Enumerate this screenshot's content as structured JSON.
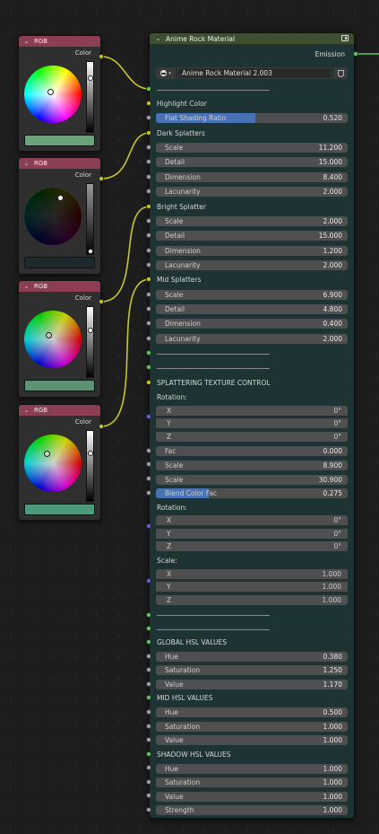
{
  "rgb_nodes": [
    {
      "title": "RGB",
      "output": "Color",
      "swatch_color": "#6aa27a"
    },
    {
      "title": "RGB",
      "output": "Color",
      "swatch_color": "#1c2a2e"
    },
    {
      "title": "RGB",
      "output": "Color",
      "swatch_color": "#5e9272"
    },
    {
      "title": "RGB",
      "output": "Color",
      "swatch_color": "#4e9a7c"
    }
  ],
  "main_node": {
    "title": "Anime Rock Material",
    "output": "Emission",
    "material_name": "Anime Rock Material 2.003",
    "highlight_color": "Highlight Color",
    "flat_shading": {
      "label": "Flat Shading Ratio",
      "value": "0.520",
      "fraction": 0.52
    },
    "dark_splatters": {
      "title": "Dark Splatters",
      "fields": [
        {
          "label": "Scale",
          "value": "11.200"
        },
        {
          "label": "Detail",
          "value": "15.000"
        },
        {
          "label": "Dimension",
          "value": "8.400"
        },
        {
          "label": "Lacunarity",
          "value": "2.000"
        }
      ]
    },
    "bright_splatter": {
      "title": "Bright Splatter",
      "fields": [
        {
          "label": "Scale",
          "value": "2.000"
        },
        {
          "label": "Detail",
          "value": "15.000"
        },
        {
          "label": "Dimension",
          "value": "1.200"
        },
        {
          "label": "Lacunarity",
          "value": "2.000"
        }
      ]
    },
    "mid_splatters": {
      "title": "Mid Splatters",
      "fields": [
        {
          "label": "Scale",
          "value": "6.900"
        },
        {
          "label": "Detail",
          "value": "4.800"
        },
        {
          "label": "Dimension",
          "value": "0.400"
        },
        {
          "label": "Lacunarity",
          "value": "2.000"
        }
      ]
    },
    "splattering": {
      "title": "SPLATTERING TEXTURE CONTROL",
      "rotation_label": "Rotation:",
      "rotation1": [
        {
          "axis": "X",
          "value": "0°"
        },
        {
          "axis": "Y",
          "value": "0°"
        },
        {
          "axis": "Z",
          "value": "0°"
        }
      ],
      "fac": {
        "label": "Fac",
        "value": "0.000"
      },
      "scale1": {
        "label": "Scale",
        "value": "8.900"
      },
      "scale2": {
        "label": "Scale",
        "value": "30.900"
      },
      "blend": {
        "label": "Blend Color Fac",
        "value": "0.275",
        "fraction": 0.275
      },
      "rotation2_label": "Rotation:",
      "rotation2": [
        {
          "axis": "X",
          "value": "0°"
        },
        {
          "axis": "Y",
          "value": "0°"
        },
        {
          "axis": "Z",
          "value": "0°"
        }
      ],
      "scale_label": "Scale:",
      "scale_vec": [
        {
          "axis": "X",
          "value": "1.000"
        },
        {
          "axis": "Y",
          "value": "1.000"
        },
        {
          "axis": "Z",
          "value": "1.000"
        }
      ]
    },
    "global_hsl": {
      "title": "GLOBAL HSL VALUES",
      "fields": [
        {
          "label": "Hue",
          "value": "0.380"
        },
        {
          "label": "Saturation",
          "value": "1.250"
        },
        {
          "label": "Value",
          "value": "1.170"
        }
      ]
    },
    "mid_hsl": {
      "title": "MID HSL VALUES",
      "fields": [
        {
          "label": "Hue",
          "value": "0.500"
        },
        {
          "label": "Saturation",
          "value": "1.000"
        },
        {
          "label": "Value",
          "value": "1.000"
        }
      ]
    },
    "shadow_hsl": {
      "title": "SHADOW HSL VALUES",
      "fields": [
        {
          "label": "Hue",
          "value": "1.000"
        },
        {
          "label": "Saturation",
          "value": "1.000"
        },
        {
          "label": "Value",
          "value": "1.000"
        },
        {
          "label": "Strength",
          "value": "1.000"
        }
      ]
    }
  }
}
